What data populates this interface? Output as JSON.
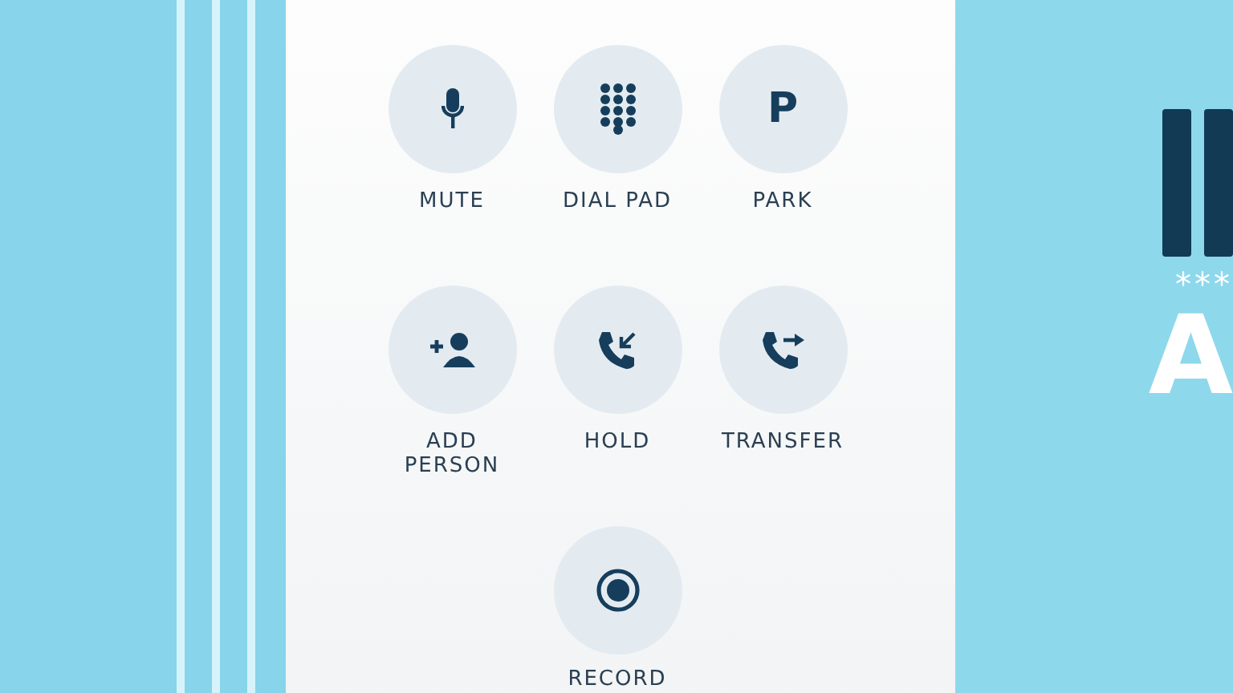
{
  "call_controls": [
    {
      "kind": "mute",
      "label": "MUTE"
    },
    {
      "kind": "dialpad",
      "label": "DIAL PAD"
    },
    {
      "kind": "park",
      "label": "PARK",
      "glyph": "P"
    },
    {
      "kind": "add-person",
      "label": "ADD PERSON"
    },
    {
      "kind": "hold",
      "label": "HOLD"
    },
    {
      "kind": "transfer",
      "label": "TRANSFER"
    },
    {
      "kind": "record",
      "label": "RECORD"
    }
  ],
  "side_banner": {
    "masked": "***",
    "letter": "A"
  }
}
